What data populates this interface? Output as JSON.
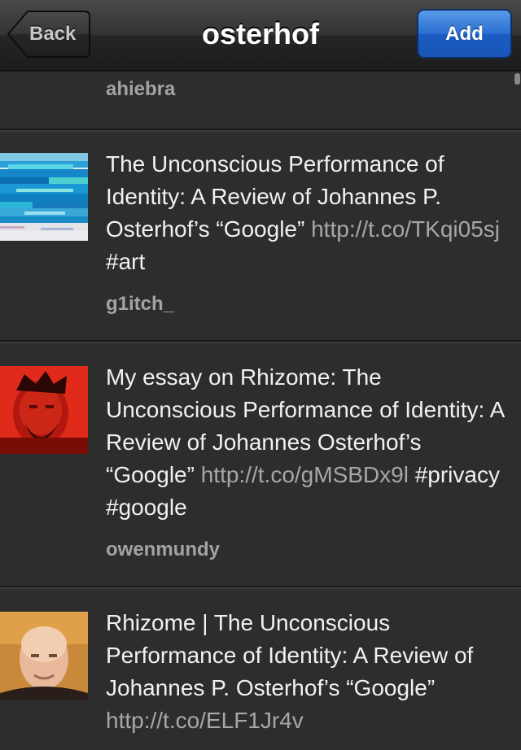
{
  "nav": {
    "back_label": "Back",
    "title": "osterhof",
    "add_label": "Add"
  },
  "tweets": [
    {
      "username": "ahiebra"
    },
    {
      "text_parts": [
        {
          "t": "The Unconscious Performance of Identity: A Review of Johannes P. Osterhof’s “Google” ",
          "link": false
        },
        {
          "t": "http://t.co/TKqi05sj",
          "link": true
        },
        {
          "t": " #art",
          "link": false
        }
      ],
      "username": "g1itch_",
      "avatar": "glitch-avatar"
    },
    {
      "text_parts": [
        {
          "t": "My essay on Rhizome: The Unconscious Performance of Identity: A Review of Johannes Osterhof’s “Google” ",
          "link": false
        },
        {
          "t": "http://t.co/gMSBDx9l",
          "link": true
        },
        {
          "t": " #privacy #google",
          "link": false
        }
      ],
      "username": "owenmundy",
      "avatar": "red-portrait-avatar"
    },
    {
      "text_parts": [
        {
          "t": "Rhizome | The Unconscious Performance of Identity: A Review of Johannes P. Osterhof’s “Google” ",
          "link": false
        },
        {
          "t": "http://t.co/ELF1Jr4v",
          "link": true
        }
      ],
      "avatar": "bald-man-avatar"
    }
  ],
  "colors": {
    "background": "#2d2d2d",
    "link": "#a7a7a7",
    "username": "#a3a3a3",
    "add_button": "#2a6fd2"
  }
}
